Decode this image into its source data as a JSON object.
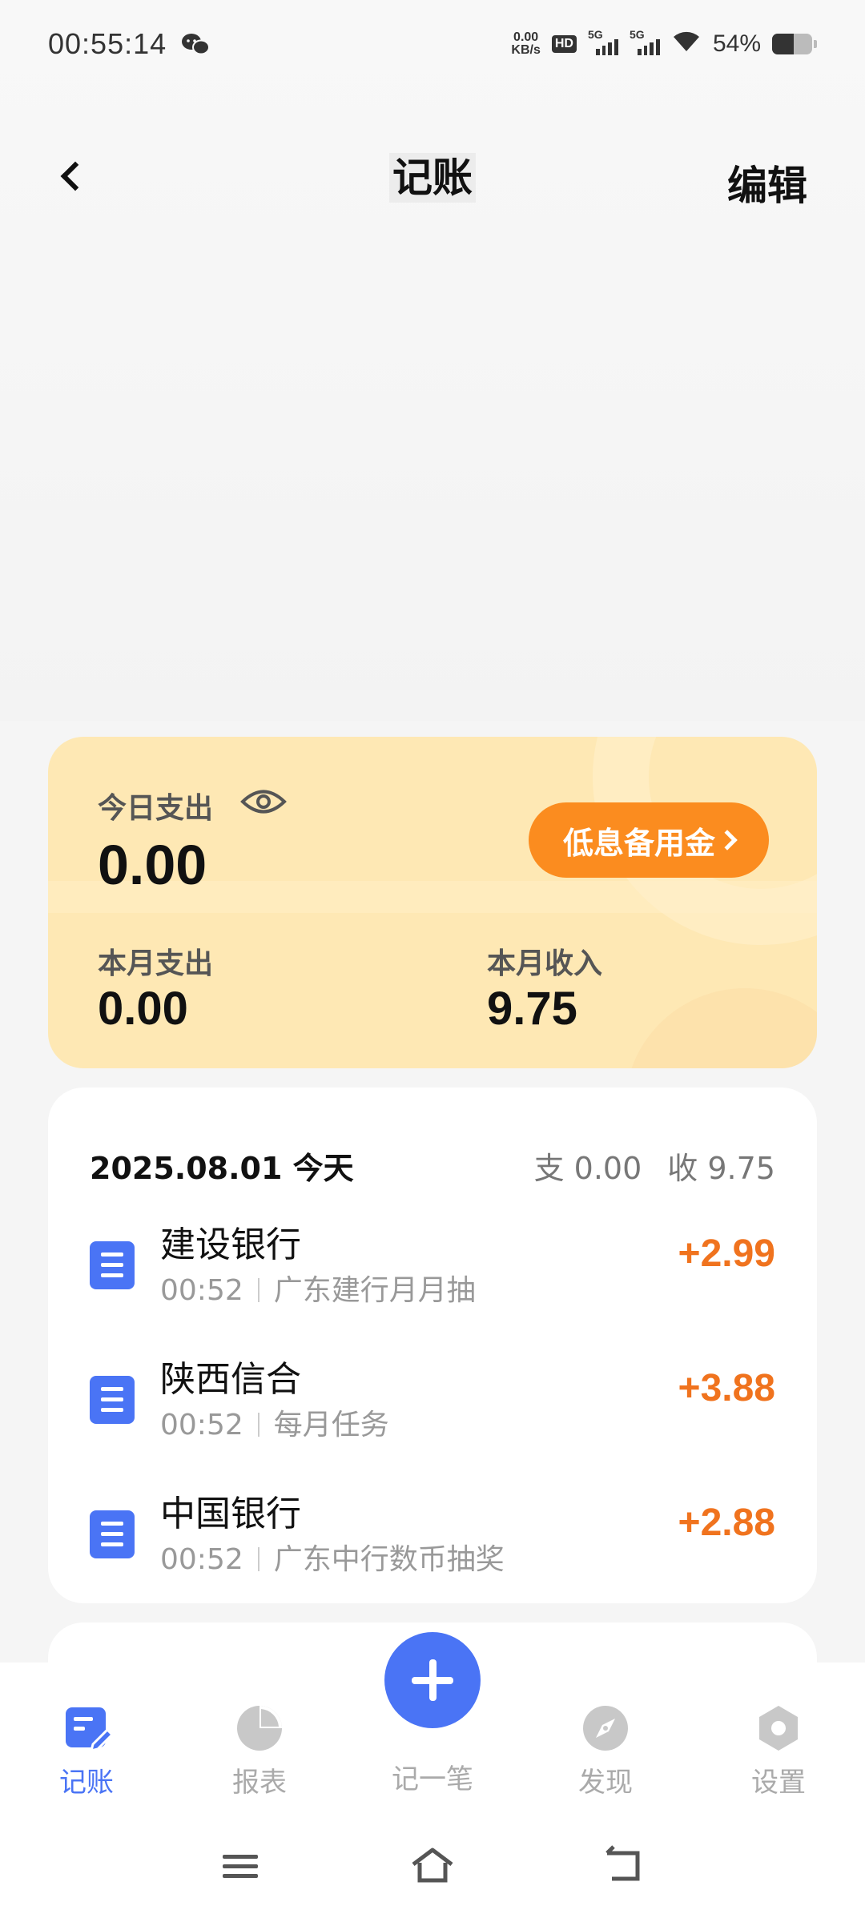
{
  "status_bar": {
    "time": "00:55:14",
    "speed_value": "0.00",
    "speed_unit": "KB/s",
    "hd": "HD",
    "sim1": "5G",
    "sim2": "5G",
    "battery": "54%",
    "battery_level": 0.54
  },
  "nav": {
    "title": "记账",
    "edit_label": "编辑"
  },
  "summary": {
    "today_label": "今日支出",
    "today_value": "0.00",
    "loan_button": "低息备用金",
    "month_expense_label": "本月支出",
    "month_expense_value": "0.00",
    "month_income_label": "本月收入",
    "month_income_value": "9.75"
  },
  "day": {
    "date": "2025.08.01 今天",
    "expense": "支 0.00",
    "income": "收 9.75"
  },
  "records": [
    {
      "name": "建设银行",
      "time": "00:52",
      "note": "广东建行月月抽",
      "amount": "+2.99"
    },
    {
      "name": "陕西信合",
      "time": "00:52",
      "note": "每月任务",
      "amount": "+3.88"
    },
    {
      "name": "中国银行",
      "time": "00:52",
      "note": "广东中行数币抽奖",
      "amount": "+2.88"
    }
  ],
  "tabs": {
    "ledger": "记账",
    "report": "报表",
    "add": "记一笔",
    "discover": "发现",
    "settings": "设置"
  },
  "colors": {
    "accent": "#4a74f5",
    "income": "#f0731e",
    "card": "#fee8b4",
    "loan_button": "#fb8c1f"
  }
}
